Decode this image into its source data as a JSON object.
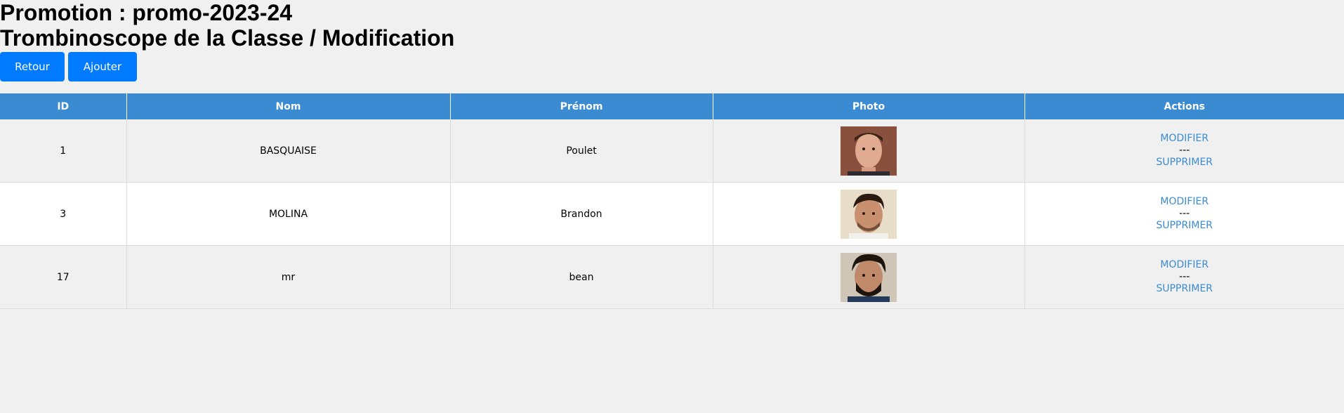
{
  "header": {
    "promotion_title": "Promotion : promo-2023-24",
    "page_title": "Trombinoscope de la Classe / Modification"
  },
  "toolbar": {
    "back_label": "Retour",
    "add_label": "Ajouter"
  },
  "table": {
    "columns": [
      "ID",
      "Nom",
      "Prénom",
      "Photo",
      "Actions"
    ],
    "rows": [
      {
        "id": "1",
        "nom": "BASQUAISE",
        "prenom": "Poulet",
        "modify": "MODIFIER",
        "sep": "---",
        "delete": "SUPPRIMER"
      },
      {
        "id": "3",
        "nom": "MOLINA",
        "prenom": "Brandon",
        "modify": "MODIFIER",
        "sep": "---",
        "delete": "SUPPRIMER"
      },
      {
        "id": "17",
        "nom": "mr",
        "prenom": "bean",
        "modify": "MODIFIER",
        "sep": "---",
        "delete": "SUPPRIMER"
      }
    ]
  },
  "colors": {
    "header_bg": "#3a8bd1",
    "button_bg": "#007bff",
    "link": "#3a8bd1"
  }
}
